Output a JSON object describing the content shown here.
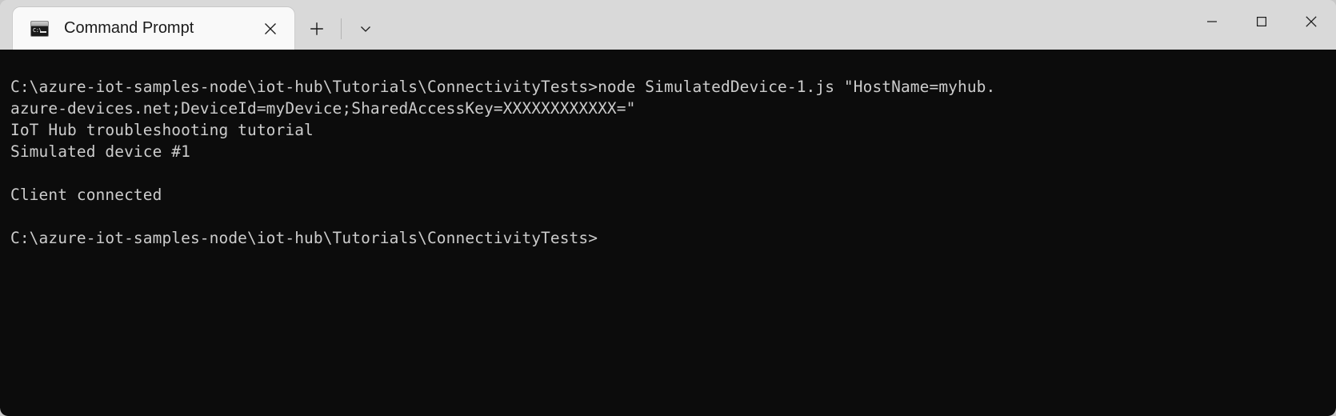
{
  "window": {
    "app_name": "Command Prompt",
    "background_color": "#d9d9d9",
    "terminal_background": "#0c0c0c",
    "terminal_foreground": "#cccccc"
  },
  "tabstrip": {
    "tabs": [
      {
        "label": "Command Prompt",
        "icon": "command-prompt-icon",
        "icon_glyph": "C:\\",
        "active": true,
        "close_label": "✕"
      }
    ],
    "new_tab_label": "+",
    "dropdown_label": "⌄"
  },
  "caption": {
    "minimize_label": "—",
    "maximize_label": "□",
    "close_label": "✕"
  },
  "terminal": {
    "lines": [
      "C:\\azure-iot-samples-node\\iot-hub\\Tutorials\\ConnectivityTests>node SimulatedDevice-1.js \"HostName=myhub.",
      "azure-devices.net;DeviceId=myDevice;SharedAccessKey=XXXXXXXXXXXX=\"",
      "IoT Hub troubleshooting tutorial",
      "Simulated device #1",
      "",
      "Client connected",
      "",
      "C:\\azure-iot-samples-node\\iot-hub\\Tutorials\\ConnectivityTests>"
    ],
    "text": "C:\\azure-iot-samples-node\\iot-hub\\Tutorials\\ConnectivityTests>node SimulatedDevice-1.js \"HostName=myhub.\nazure-devices.net;DeviceId=myDevice;SharedAccessKey=XXXXXXXXXXXX=\"\nIoT Hub troubleshooting tutorial\nSimulated device #1\n\nClient connected\n\nC:\\azure-iot-samples-node\\iot-hub\\Tutorials\\ConnectivityTests>",
    "prompt_path": "C:\\azure-iot-samples-node\\iot-hub\\Tutorials\\ConnectivityTests>",
    "command": "node SimulatedDevice-1.js \"HostName=myhub.azure-devices.net;DeviceId=myDevice;SharedAccessKey=XXXXXXXXXXXX=\""
  }
}
